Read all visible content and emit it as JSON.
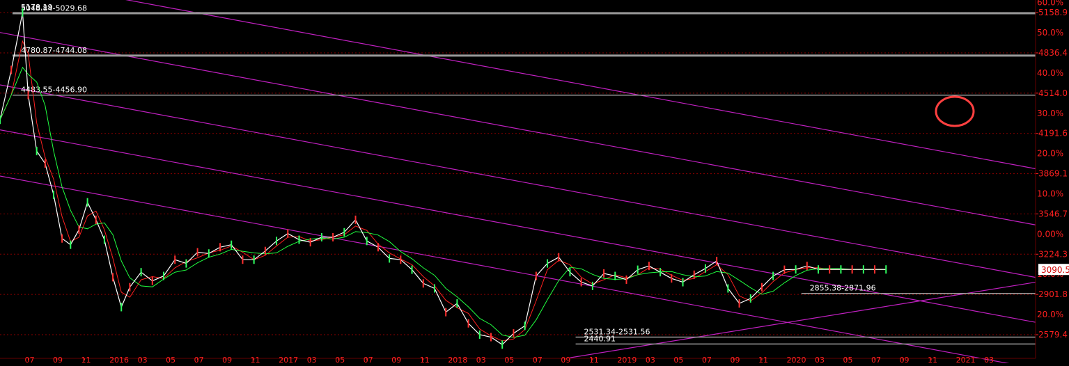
{
  "chart_data": {
    "type": "line",
    "title": "",
    "xlabel": "",
    "ylabel": "",
    "ylim": [
      2390,
      5260
    ],
    "y_ticks": [
      {
        "value": 5158.9,
        "label": "5158.9"
      },
      {
        "value": 4836.4,
        "label": "4836.4"
      },
      {
        "value": 4514.0,
        "label": "4514.0"
      },
      {
        "value": 4191.6,
        "label": "4191.6"
      },
      {
        "value": 3869.1,
        "label": "3869.1"
      },
      {
        "value": 3546.7,
        "label": "3546.7"
      },
      {
        "value": 3224.3,
        "label": "3224.3"
      },
      {
        "value": 2901.8,
        "label": "2901.8"
      },
      {
        "value": 2579.4,
        "label": "2579.4"
      }
    ],
    "pct_ticks": [
      {
        "value": 5240,
        "label": "60.0%"
      },
      {
        "value": 4997,
        "label": "50.0%"
      },
      {
        "value": 4675,
        "label": "40.0%"
      },
      {
        "value": 4352,
        "label": "30.0%"
      },
      {
        "value": 4030,
        "label": "20.0%"
      },
      {
        "value": 3708,
        "label": "10.0%"
      },
      {
        "value": 3385,
        "label": "0.00%"
      },
      {
        "value": 3063,
        "label": "10.0%"
      },
      {
        "value": 2740,
        "label": "20.0%"
      }
    ],
    "current_price": {
      "value": 3102,
      "label": "3090.5"
    },
    "x_ticks": [
      "07",
      "09",
      "11",
      "2016",
      "03",
      "05",
      "07",
      "09",
      "11",
      "2017",
      "03",
      "05",
      "07",
      "09",
      "11",
      "2018",
      "03",
      "05",
      "07",
      "09",
      "11",
      "2019",
      "03",
      "05",
      "07",
      "09",
      "11",
      "2020",
      "03",
      "05",
      "07",
      "09",
      "11",
      "2021",
      "03"
    ],
    "x_range": [
      0,
      36.7
    ],
    "price_levels": [
      {
        "value": 5160,
        "label": "5178.19"
      },
      {
        "value": 5150,
        "label": "5048.84-5029.68"
      },
      {
        "value": 4815,
        "label": "4780.87-4744.08"
      },
      {
        "value": 4498,
        "label": "4483.55-4456.90"
      },
      {
        "value": 2910,
        "label": "2855.38-2871.96"
      },
      {
        "value": 2560,
        "label": "2531.34-2531.56"
      },
      {
        "value": 2505,
        "label": "2440.91"
      }
    ],
    "series": [
      {
        "name": "",
        "x": [
          0.0,
          0.4,
          0.8,
          1.0,
          1.3,
          1.6,
          1.9,
          2.2,
          2.5,
          2.8,
          3.1,
          3.4,
          3.7,
          4.0,
          4.3,
          4.6,
          5.0,
          5.4,
          5.8,
          6.2,
          6.6,
          7.0,
          7.4,
          7.8,
          8.2,
          8.6,
          9.0,
          9.4,
          9.8,
          10.2,
          10.6,
          11.0,
          11.4,
          11.8,
          12.2,
          12.6,
          13.0,
          13.4,
          13.8,
          14.2,
          14.6,
          15.0,
          15.4,
          15.8,
          16.2,
          16.6,
          17.0,
          17.4,
          17.8,
          18.2,
          18.6,
          19.0,
          19.4,
          19.8,
          20.2,
          20.6,
          21.0,
          21.4,
          21.8,
          22.2,
          22.6,
          23.0,
          23.4,
          23.8,
          24.2,
          24.6,
          25.0,
          25.4,
          25.8,
          26.2,
          26.6,
          27.0,
          27.4,
          27.8,
          28.2,
          28.6,
          29.0,
          29.4,
          29.8,
          30.2,
          30.6,
          31.0,
          31.4
        ],
        "values": [
          4300,
          4700,
          5160,
          4500,
          4050,
          3950,
          3700,
          3350,
          3300,
          3420,
          3640,
          3500,
          3340,
          3040,
          2800,
          2960,
          3080,
          3010,
          3050,
          3180,
          3150,
          3240,
          3230,
          3280,
          3300,
          3180,
          3180,
          3250,
          3330,
          3390,
          3340,
          3320,
          3360,
          3360,
          3400,
          3500,
          3330,
          3280,
          3190,
          3180,
          3100,
          2990,
          2950,
          2760,
          2830,
          2670,
          2580,
          2560,
          2500,
          2590,
          2650,
          3050,
          3150,
          3200,
          3080,
          3000,
          2970,
          3070,
          3050,
          3020,
          3100,
          3130,
          3080,
          3030,
          3000,
          3060,
          3110,
          3170,
          2950,
          2830,
          2870,
          2960,
          3050,
          3100,
          3102,
          3130,
          3102,
          3102,
          3102,
          3102,
          3102,
          3102,
          3102
        ]
      }
    ],
    "grid": true,
    "legend": "none",
    "colors": {
      "background": "#000000",
      "price": "#ffffff",
      "ma_fast": "#ff2020",
      "ma_slow": "#20ff40",
      "channel": "#c020c0",
      "grid": "#8b0000",
      "axis_text": "#ff2020",
      "level_text": "#ffffff",
      "marker_circle": "#ff4040",
      "price_label_bg": "#ffffff"
    }
  }
}
